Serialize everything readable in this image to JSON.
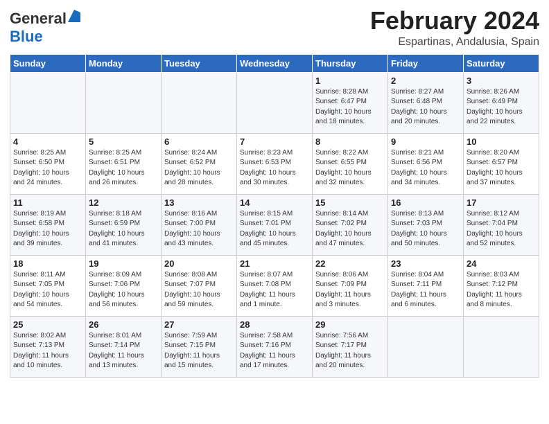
{
  "logo": {
    "general": "General",
    "blue": "Blue"
  },
  "title": "February 2024",
  "subtitle": "Espartinas, Andalusia, Spain",
  "days_of_week": [
    "Sunday",
    "Monday",
    "Tuesday",
    "Wednesday",
    "Thursday",
    "Friday",
    "Saturday"
  ],
  "weeks": [
    [
      {
        "day": "",
        "info": ""
      },
      {
        "day": "",
        "info": ""
      },
      {
        "day": "",
        "info": ""
      },
      {
        "day": "",
        "info": ""
      },
      {
        "day": "1",
        "info": "Sunrise: 8:28 AM\nSunset: 6:47 PM\nDaylight: 10 hours\nand 18 minutes."
      },
      {
        "day": "2",
        "info": "Sunrise: 8:27 AM\nSunset: 6:48 PM\nDaylight: 10 hours\nand 20 minutes."
      },
      {
        "day": "3",
        "info": "Sunrise: 8:26 AM\nSunset: 6:49 PM\nDaylight: 10 hours\nand 22 minutes."
      }
    ],
    [
      {
        "day": "4",
        "info": "Sunrise: 8:25 AM\nSunset: 6:50 PM\nDaylight: 10 hours\nand 24 minutes."
      },
      {
        "day": "5",
        "info": "Sunrise: 8:25 AM\nSunset: 6:51 PM\nDaylight: 10 hours\nand 26 minutes."
      },
      {
        "day": "6",
        "info": "Sunrise: 8:24 AM\nSunset: 6:52 PM\nDaylight: 10 hours\nand 28 minutes."
      },
      {
        "day": "7",
        "info": "Sunrise: 8:23 AM\nSunset: 6:53 PM\nDaylight: 10 hours\nand 30 minutes."
      },
      {
        "day": "8",
        "info": "Sunrise: 8:22 AM\nSunset: 6:55 PM\nDaylight: 10 hours\nand 32 minutes."
      },
      {
        "day": "9",
        "info": "Sunrise: 8:21 AM\nSunset: 6:56 PM\nDaylight: 10 hours\nand 34 minutes."
      },
      {
        "day": "10",
        "info": "Sunrise: 8:20 AM\nSunset: 6:57 PM\nDaylight: 10 hours\nand 37 minutes."
      }
    ],
    [
      {
        "day": "11",
        "info": "Sunrise: 8:19 AM\nSunset: 6:58 PM\nDaylight: 10 hours\nand 39 minutes."
      },
      {
        "day": "12",
        "info": "Sunrise: 8:18 AM\nSunset: 6:59 PM\nDaylight: 10 hours\nand 41 minutes."
      },
      {
        "day": "13",
        "info": "Sunrise: 8:16 AM\nSunset: 7:00 PM\nDaylight: 10 hours\nand 43 minutes."
      },
      {
        "day": "14",
        "info": "Sunrise: 8:15 AM\nSunset: 7:01 PM\nDaylight: 10 hours\nand 45 minutes."
      },
      {
        "day": "15",
        "info": "Sunrise: 8:14 AM\nSunset: 7:02 PM\nDaylight: 10 hours\nand 47 minutes."
      },
      {
        "day": "16",
        "info": "Sunrise: 8:13 AM\nSunset: 7:03 PM\nDaylight: 10 hours\nand 50 minutes."
      },
      {
        "day": "17",
        "info": "Sunrise: 8:12 AM\nSunset: 7:04 PM\nDaylight: 10 hours\nand 52 minutes."
      }
    ],
    [
      {
        "day": "18",
        "info": "Sunrise: 8:11 AM\nSunset: 7:05 PM\nDaylight: 10 hours\nand 54 minutes."
      },
      {
        "day": "19",
        "info": "Sunrise: 8:09 AM\nSunset: 7:06 PM\nDaylight: 10 hours\nand 56 minutes."
      },
      {
        "day": "20",
        "info": "Sunrise: 8:08 AM\nSunset: 7:07 PM\nDaylight: 10 hours\nand 59 minutes."
      },
      {
        "day": "21",
        "info": "Sunrise: 8:07 AM\nSunset: 7:08 PM\nDaylight: 11 hours\nand 1 minute."
      },
      {
        "day": "22",
        "info": "Sunrise: 8:06 AM\nSunset: 7:09 PM\nDaylight: 11 hours\nand 3 minutes."
      },
      {
        "day": "23",
        "info": "Sunrise: 8:04 AM\nSunset: 7:11 PM\nDaylight: 11 hours\nand 6 minutes."
      },
      {
        "day": "24",
        "info": "Sunrise: 8:03 AM\nSunset: 7:12 PM\nDaylight: 11 hours\nand 8 minutes."
      }
    ],
    [
      {
        "day": "25",
        "info": "Sunrise: 8:02 AM\nSunset: 7:13 PM\nDaylight: 11 hours\nand 10 minutes."
      },
      {
        "day": "26",
        "info": "Sunrise: 8:01 AM\nSunset: 7:14 PM\nDaylight: 11 hours\nand 13 minutes."
      },
      {
        "day": "27",
        "info": "Sunrise: 7:59 AM\nSunset: 7:15 PM\nDaylight: 11 hours\nand 15 minutes."
      },
      {
        "day": "28",
        "info": "Sunrise: 7:58 AM\nSunset: 7:16 PM\nDaylight: 11 hours\nand 17 minutes."
      },
      {
        "day": "29",
        "info": "Sunrise: 7:56 AM\nSunset: 7:17 PM\nDaylight: 11 hours\nand 20 minutes."
      },
      {
        "day": "",
        "info": ""
      },
      {
        "day": "",
        "info": ""
      }
    ]
  ]
}
